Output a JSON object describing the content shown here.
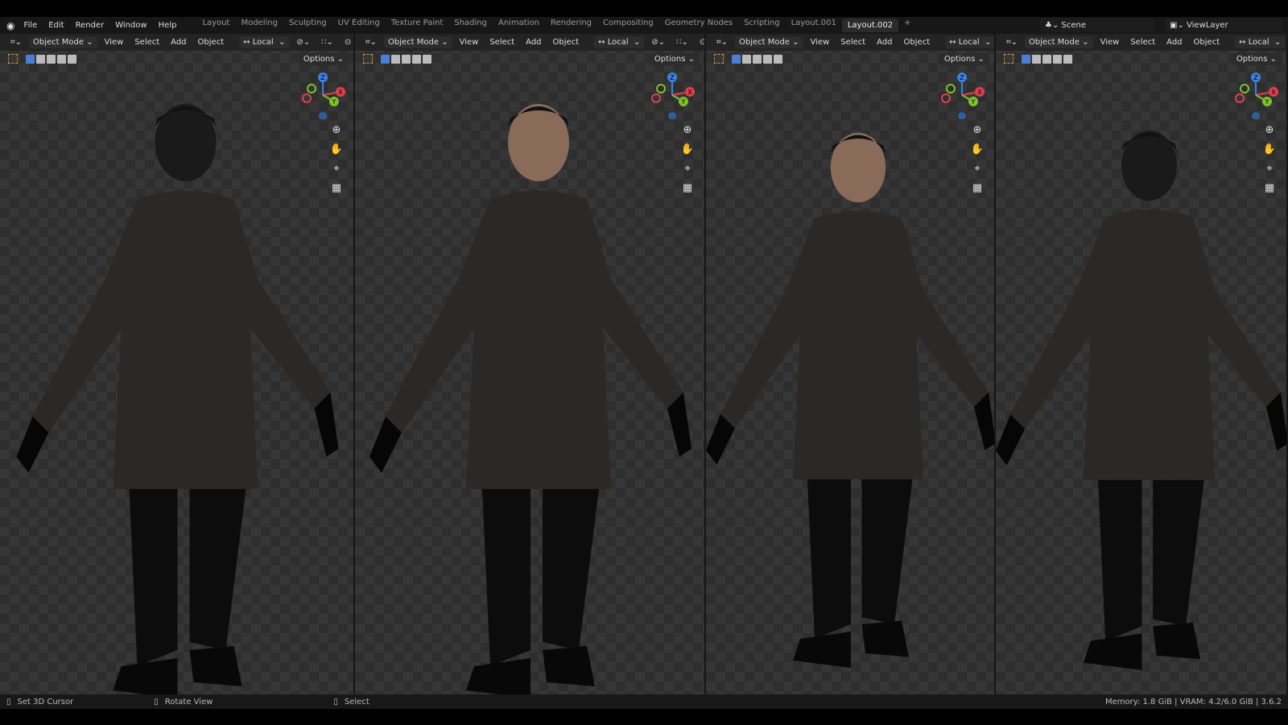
{
  "menu": [
    "File",
    "Edit",
    "Render",
    "Window",
    "Help"
  ],
  "workspaces": [
    "Layout",
    "Modeling",
    "Sculpting",
    "UV Editing",
    "Texture Paint",
    "Shading",
    "Animation",
    "Rendering",
    "Compositing",
    "Geometry Nodes",
    "Scripting",
    "Layout.001",
    "Layout.002"
  ],
  "active_workspace": "Layout.002",
  "scene": "Scene",
  "view_layer": "ViewLayer",
  "viewport": {
    "mode": "Object Mode",
    "menus": [
      "View",
      "Select",
      "Add",
      "Object"
    ],
    "orientation": "Local",
    "options": "Options"
  },
  "axes": {
    "x": "X",
    "y": "Y",
    "z": "Z"
  },
  "status": {
    "left": "Set 3D Cursor",
    "middle": "Rotate View",
    "right": "Select",
    "info": "Memory: 1.8 GiB | VRAM: 4.2/6.0 GiB | 3.6.2"
  }
}
